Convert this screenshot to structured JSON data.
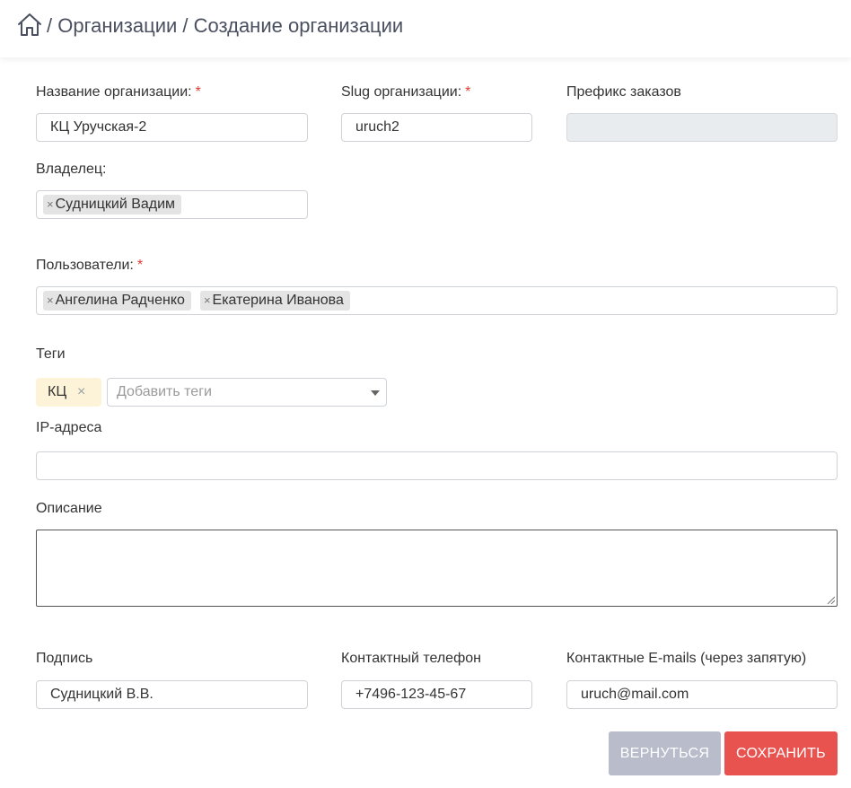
{
  "header": {
    "breadcrumb": "/ Организации / Создание организации"
  },
  "form": {
    "org_name": {
      "label": "Название организации:",
      "required": "*",
      "value": "КЦ Уручская-2"
    },
    "slug": {
      "label": "Slug организации:",
      "required": "*",
      "value": "uruch2"
    },
    "prefix": {
      "label": "Префикс заказов",
      "value": ""
    },
    "owner": {
      "label": "Владелец:",
      "chips": [
        "Судницкий Вадим"
      ]
    },
    "users": {
      "label": "Пользователи:",
      "required": "*",
      "chips": [
        "Ангелина Радченко",
        "Екатерина Иванова"
      ]
    },
    "tags": {
      "label": "Теги",
      "selected": "КЦ",
      "remove_glyph": "×",
      "placeholder": "Добавить теги"
    },
    "ip": {
      "label": "IP-адреса",
      "value": ""
    },
    "description": {
      "label": "Описание",
      "value": ""
    },
    "signature": {
      "label": "Подпись",
      "value": "Судницкий В.В."
    },
    "phone": {
      "label": "Контактный телефон",
      "value": "+7496-123-45-67"
    },
    "emails": {
      "label": "Контактные E-mails (через запятую)",
      "value": "uruch@mail.com"
    }
  },
  "chip_remove_glyph": "×",
  "buttons": {
    "back": "Вернуться",
    "save": "Сохранить"
  },
  "colors": {
    "save": "#e9534f",
    "back": "#b8bccb",
    "tag_bg": "#fdf3d8",
    "required": "#e53935"
  }
}
